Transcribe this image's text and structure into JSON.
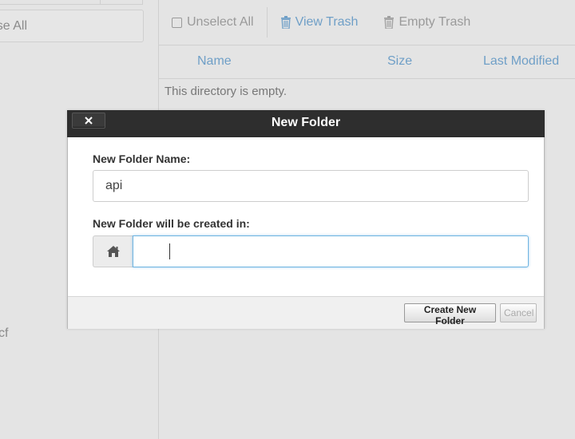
{
  "background": {
    "sidebar": {
      "collapse_label": "se All",
      "side_text": "cf"
    },
    "toolbar": {
      "unselect_all": "Unselect All",
      "view_trash": "View Trash",
      "empty_trash": "Empty Trash"
    },
    "table": {
      "columns": [
        "Name",
        "Size",
        "Last Modified"
      ],
      "empty_message": "This directory is empty."
    }
  },
  "dialog": {
    "title": "New Folder",
    "close_label": "×",
    "folder_name_label": "New Folder Name:",
    "folder_name_value": "api",
    "location_label": "New Folder will be created in:",
    "location_value": "",
    "create_button": "Create New Folder",
    "cancel_button": "Cancel"
  },
  "icons": {
    "close": "close-icon",
    "home": "home-icon",
    "trash": "trash-icon",
    "checkbox": "checkbox-icon"
  },
  "colors": {
    "link": "#6f9fc7",
    "dialog_header": "#2e2e2e",
    "focus_border": "#6fb4e0"
  }
}
